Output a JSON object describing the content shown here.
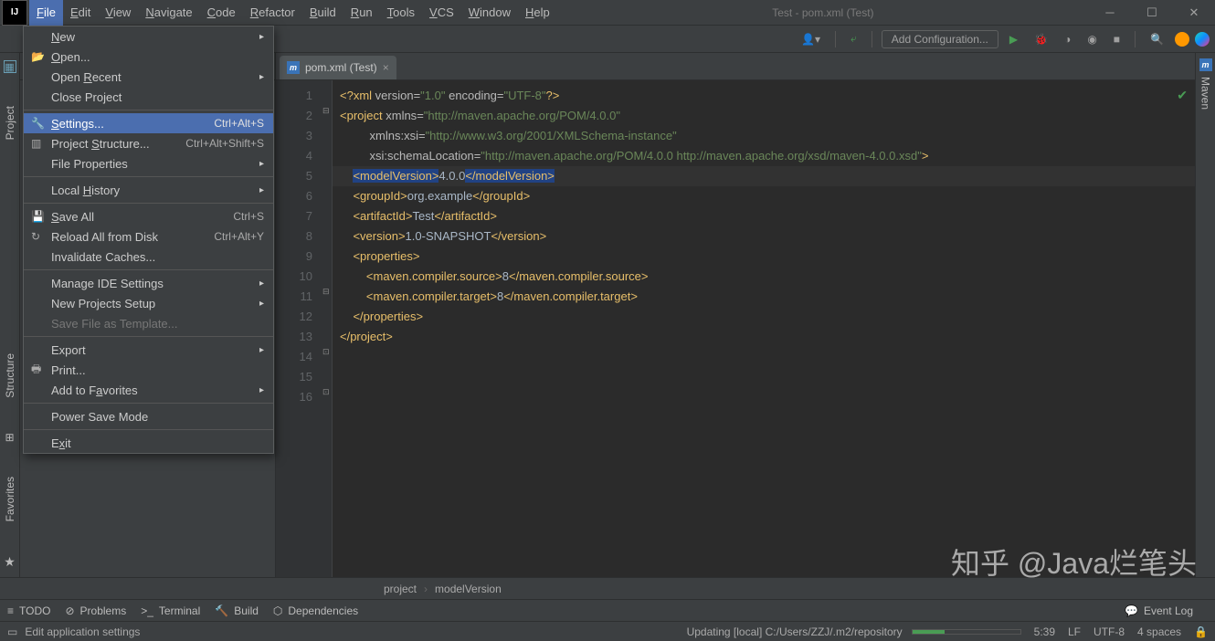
{
  "window": {
    "title": "Test - pom.xml (Test)"
  },
  "menubar": [
    "File",
    "Edit",
    "View",
    "Navigate",
    "Code",
    "Refactor",
    "Build",
    "Run",
    "Tools",
    "VCS",
    "Window",
    "Help"
  ],
  "fileMenu": [
    {
      "type": "item",
      "label": "New",
      "arrow": true,
      "u": 0
    },
    {
      "type": "item",
      "label": "Open...",
      "icon": "📂",
      "u": 0
    },
    {
      "type": "item",
      "label": "Open Recent",
      "arrow": true,
      "u": 5
    },
    {
      "type": "item",
      "label": "Close Project"
    },
    {
      "type": "divider"
    },
    {
      "type": "item",
      "label": "Settings...",
      "shortcut": "Ctrl+Alt+S",
      "icon": "🔧",
      "hl": true,
      "u": 0
    },
    {
      "type": "item",
      "label": "Project Structure...",
      "shortcut": "Ctrl+Alt+Shift+S",
      "icon": "▥",
      "u": 8
    },
    {
      "type": "item",
      "label": "File Properties",
      "arrow": true
    },
    {
      "type": "divider"
    },
    {
      "type": "item",
      "label": "Local History",
      "arrow": true,
      "u": 6
    },
    {
      "type": "divider"
    },
    {
      "type": "item",
      "label": "Save All",
      "shortcut": "Ctrl+S",
      "icon": "💾",
      "u": 0
    },
    {
      "type": "item",
      "label": "Reload All from Disk",
      "shortcut": "Ctrl+Alt+Y",
      "icon": "↻"
    },
    {
      "type": "item",
      "label": "Invalidate Caches..."
    },
    {
      "type": "divider"
    },
    {
      "type": "item",
      "label": "Manage IDE Settings",
      "arrow": true
    },
    {
      "type": "item",
      "label": "New Projects Setup",
      "arrow": true
    },
    {
      "type": "item",
      "label": "Save File as Template...",
      "disabled": true
    },
    {
      "type": "divider"
    },
    {
      "type": "item",
      "label": "Export",
      "arrow": true
    },
    {
      "type": "item",
      "label": "Print...",
      "icon": "🖶"
    },
    {
      "type": "item",
      "label": "Add to Favorites",
      "arrow": true,
      "u": 8
    },
    {
      "type": "divider"
    },
    {
      "type": "item",
      "label": "Power Save Mode"
    },
    {
      "type": "divider"
    },
    {
      "type": "item",
      "label": "Exit",
      "u": 1
    }
  ],
  "toolbar": {
    "addConfig": "Add Configuration..."
  },
  "leftTabs": [
    "Project",
    "Structure",
    "Favorites"
  ],
  "rightTab": "Maven",
  "editorTab": {
    "label": "pom.xml (Test)"
  },
  "lineNumbers": [
    1,
    2,
    3,
    4,
    5,
    6,
    7,
    8,
    9,
    10,
    11,
    12,
    13,
    14,
    15,
    16
  ],
  "code": {
    "l1": {
      "pre": "<?",
      "name": "xml",
      "attrs": " version",
      "v1": "\"1.0\"",
      "a2": " encoding",
      "v2": "\"UTF-8\"",
      "post": "?>"
    },
    "l2": {
      "open": "<",
      "name": "project",
      "a1": " xmlns",
      "v1": "\"http://maven.apache.org/POM/4.0.0\""
    },
    "l3": {
      "a": "xmlns:xsi",
      "v": "\"http://www.w3.org/2001/XMLSchema-instance\""
    },
    "l4": {
      "a": "xsi:schemaLocation",
      "v": "\"http://maven.apache.org/POM/4.0.0 http://maven.apache.org/xsd/maven-4.0.0.xsd\"",
      "close": ">"
    },
    "l5": {
      "o": "<modelVersion>",
      "t": "4.0.0",
      "c": "</modelVersion>"
    },
    "l7": {
      "o": "<groupId>",
      "t": "org.example",
      "c": "</groupId>"
    },
    "l8": {
      "o": "<artifactId>",
      "t": "Test",
      "c": "</artifactId>"
    },
    "l9": {
      "o": "<version>",
      "t": "1.0-SNAPSHOT",
      "c": "</version>"
    },
    "l11": {
      "o": "<properties>"
    },
    "l12": {
      "o": "<maven.compiler.source>",
      "t": "8",
      "c": "</maven.compiler.source>"
    },
    "l13": {
      "o": "<maven.compiler.target>",
      "t": "8",
      "c": "</maven.compiler.target>"
    },
    "l14": {
      "c": "</properties>"
    },
    "l16": {
      "c": "</project>"
    }
  },
  "breadcrumb": [
    "project",
    "modelVersion"
  ],
  "bottomTools": [
    {
      "icon": "≡",
      "label": "TODO"
    },
    {
      "icon": "⊘",
      "label": "Problems"
    },
    {
      "icon": ">_",
      "label": "Terminal"
    },
    {
      "icon": "🔨",
      "label": "Build",
      "color": "#499c54"
    },
    {
      "icon": "⬡",
      "label": "Dependencies"
    }
  ],
  "eventLog": "Event Log",
  "status": {
    "hint": "Edit application settings",
    "progress": "Updating [local] C:/Users/ZZJ/.m2/repository",
    "pos": "5:39",
    "lf": "LF",
    "enc": "UTF-8",
    "indent": "4 spaces"
  },
  "watermark": "知乎 @Java烂笔头"
}
